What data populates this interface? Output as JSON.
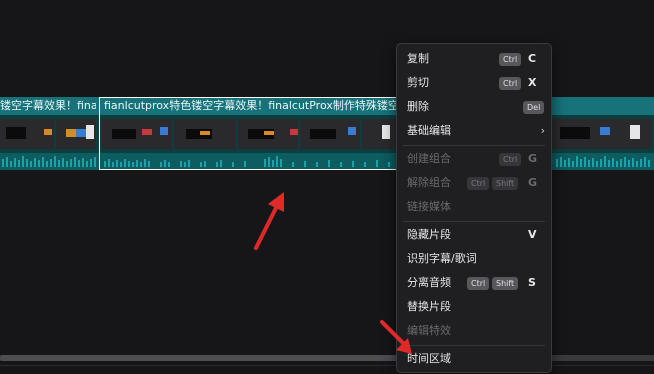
{
  "timeline": {
    "text_clip_left": "镂空字幕效果！finalcut",
    "text_clip_selected": "fianlcutprox特色镂空字幕效果！finalcutProx制作特殊镂空字幕效果！",
    "audio_pill_glyph": "A"
  },
  "context_menu": {
    "items": [
      {
        "label": "复制",
        "keys": [
          "Ctrl"
        ],
        "letter": "C",
        "disabled": false
      },
      {
        "label": "剪切",
        "keys": [
          "Ctrl"
        ],
        "letter": "X",
        "disabled": false
      },
      {
        "label": "删除",
        "keys": [
          "Del"
        ],
        "letter": "",
        "disabled": false
      },
      {
        "label": "基础编辑",
        "keys": [],
        "letter": "",
        "disabled": false,
        "submenu": "›"
      },
      {
        "label": "创建组合",
        "keys": [
          "Ctrl"
        ],
        "letter": "G",
        "disabled": true
      },
      {
        "label": "解除组合",
        "keys": [
          "Ctrl",
          "Shift"
        ],
        "letter": "G",
        "disabled": true
      },
      {
        "label": "链接媒体",
        "keys": [],
        "letter": "",
        "disabled": true
      },
      {
        "label": "隐藏片段",
        "keys": [],
        "letter": "V",
        "disabled": false
      },
      {
        "label": "识别字幕/歌词",
        "keys": [],
        "letter": "",
        "disabled": false
      },
      {
        "label": "分离音频",
        "keys": [
          "Ctrl",
          "Shift"
        ],
        "letter": "S",
        "disabled": false
      },
      {
        "label": "替换片段",
        "keys": [],
        "letter": "",
        "disabled": false
      },
      {
        "label": "编辑特效",
        "keys": [],
        "letter": "",
        "disabled": true
      },
      {
        "label": "时间区域",
        "keys": [],
        "letter": "",
        "disabled": false
      }
    ]
  },
  "colors": {
    "menu_bg": "#1f1f21",
    "teal_track": "#17727a",
    "audio_pill": "#b05a4c",
    "arrow": "#e02a2a"
  }
}
